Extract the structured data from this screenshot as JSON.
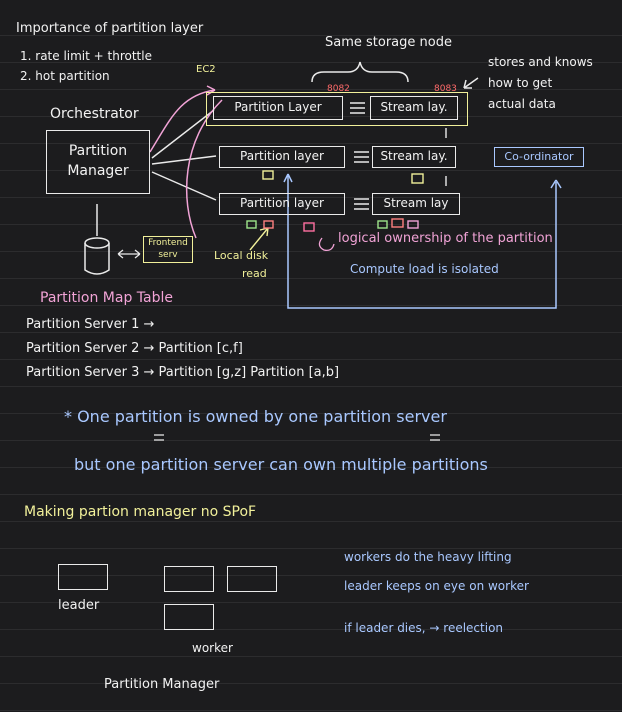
{
  "importance": {
    "title": "Importance of partition layer",
    "items": [
      "1. rate limit + throttle",
      "2. hot partition"
    ]
  },
  "orchestrator_label": "Orchestrator",
  "partition_manager": "Partition Manager",
  "same_storage_node": "Same storage node",
  "port_a": "8082",
  "port_b": "8083",
  "ec2": "EC2",
  "stores_note": [
    "stores and knows",
    "how to get",
    "actual data"
  ],
  "rows": [
    {
      "partition": "Partition Layer",
      "stream": "Stream lay."
    },
    {
      "partition": "Partition layer",
      "stream": "Stream lay."
    },
    {
      "partition": "Partition layer",
      "stream": "Stream lay"
    }
  ],
  "coordinator": "Co-ordinator",
  "frontend": [
    "Frontend",
    "serv"
  ],
  "local_disk": [
    "Local disk",
    "read"
  ],
  "logical_ownership": "logical ownership of the partition",
  "compute_isolated": "Compute load is isolated",
  "map_table": {
    "title": "Partition Map Table",
    "rows": [
      "Partition Server 1 →",
      "Partition Server 2 → Partition [c,f]",
      "Partition Server 3 → Partition [g,z]   Partition [a,b]"
    ]
  },
  "rule_line1": "* One partition is owned by one partition server",
  "rule_line2": "but one partition server can own multiple partitions",
  "spof_title": "Making partion manager no SPoF",
  "leader_label": "leader",
  "worker_label": "worker",
  "pm_label": "Partition Manager",
  "notes": [
    "workers do the heavy lifting",
    "leader keeps on eye on worker",
    "if leader dies, → reelection"
  ]
}
